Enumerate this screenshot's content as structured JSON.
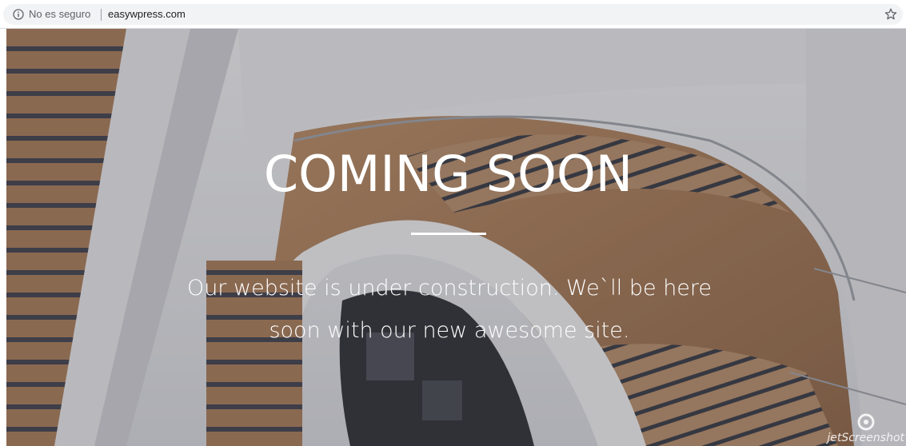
{
  "browser": {
    "security_label": "No es seguro",
    "url": "easywpress.com",
    "info_icon": "info-icon",
    "bookmark_icon": "star-icon"
  },
  "page": {
    "headline": "COMING SOON",
    "subtitle": "Our website is under construction. We`ll be here soon with our new awesome site.",
    "text_color": "#ffffff",
    "overlay_color": "#3c3e46"
  },
  "watermark": {
    "text": "jetScreenshot"
  }
}
